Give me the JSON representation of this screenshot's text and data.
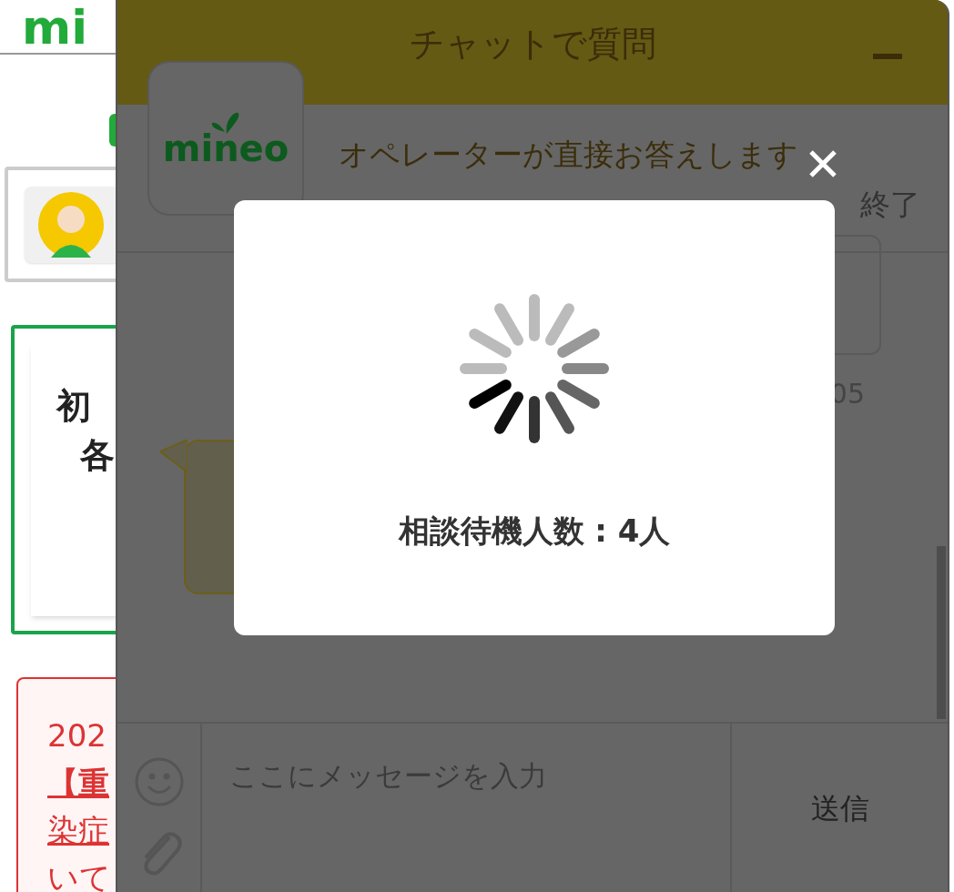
{
  "page": {
    "logo": "mi",
    "card_lines": [
      "初",
      "各"
    ],
    "notice_lines": [
      {
        "text": "202",
        "link": false
      },
      {
        "text": "【重",
        "link": true
      },
      {
        "text": "染症",
        "link": true
      },
      {
        "text": "いて",
        "link": false
      }
    ]
  },
  "chat": {
    "title": "チャットで質問",
    "brand": "mineo",
    "heading": "オペレーターが直接お答えします",
    "end_button": "終了",
    "messages": [
      {
        "kind": "outgoing",
        "time": "05"
      },
      {
        "kind": "incoming"
      }
    ],
    "input": {
      "placeholder": "ここにメッセージを入力"
    },
    "send_button": "送信"
  },
  "modal": {
    "status": "相談待機人数 : 4人"
  }
}
